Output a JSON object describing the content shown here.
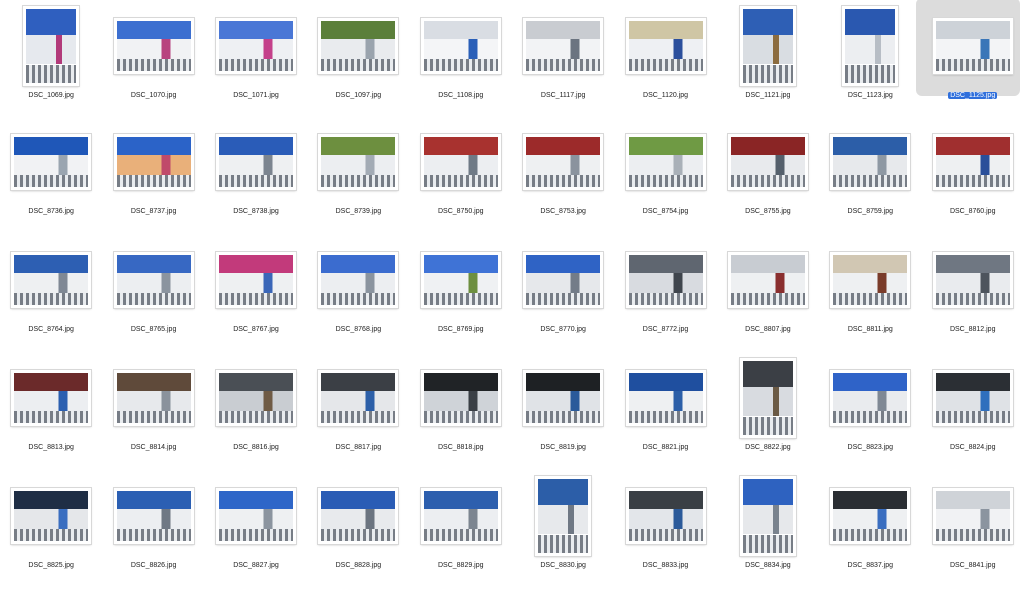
{
  "colors": {
    "selection": "#2f6fdc",
    "selectionBg": "#dcdcdc"
  },
  "files": [
    {
      "name": "DSC_1069.jpg",
      "orient": "portrait",
      "colors": [
        "#2f5fbf",
        "#e6e9ee",
        "#b23a7a"
      ]
    },
    {
      "name": "DSC_1070.jpg",
      "orient": "landscape",
      "colors": [
        "#3c6fd0",
        "#f1f2f4",
        "#b8447f"
      ]
    },
    {
      "name": "DSC_1071.jpg",
      "orient": "landscape",
      "colors": [
        "#4a77d6",
        "#eef0f3",
        "#c4408a"
      ]
    },
    {
      "name": "DSC_1097.jpg",
      "orient": "landscape",
      "colors": [
        "#5b7f3a",
        "#e9ebee",
        "#9aa3ad"
      ]
    },
    {
      "name": "DSC_1108.jpg",
      "orient": "landscape",
      "colors": [
        "#d9dde3",
        "#f4f5f7",
        "#2a5fb8"
      ]
    },
    {
      "name": "DSC_1117.jpg",
      "orient": "landscape",
      "colors": [
        "#c9ccd1",
        "#f2f3f5",
        "#6b7480"
      ]
    },
    {
      "name": "DSC_1120.jpg",
      "orient": "landscape",
      "colors": [
        "#cfc6a5",
        "#eef0f3",
        "#2b4f9c"
      ]
    },
    {
      "name": "DSC_1121.jpg",
      "orient": "portrait",
      "colors": [
        "#2e5fb5",
        "#d9dde2",
        "#8c6c3f"
      ]
    },
    {
      "name": "DSC_1123.jpg",
      "orient": "portrait",
      "colors": [
        "#2a58b0",
        "#eceef1",
        "#b7bdc5"
      ]
    },
    {
      "name": "DSC_1125.jpg",
      "orient": "landscape",
      "colors": [
        "#cdd2d8",
        "#f3f4f6",
        "#3a76b8"
      ],
      "selected": true
    },
    {
      "name": "DSC_8736.jpg",
      "orient": "landscape",
      "colors": [
        "#1f57b8",
        "#f1f2f4",
        "#9aa5b0"
      ]
    },
    {
      "name": "DSC_8737.jpg",
      "orient": "landscape",
      "colors": [
        "#2b63c8",
        "#e9b07a",
        "#c04a6a"
      ]
    },
    {
      "name": "DSC_8738.jpg",
      "orient": "landscape",
      "colors": [
        "#2a5cb8",
        "#eef0f2",
        "#7c8590"
      ]
    },
    {
      "name": "DSC_8739.jpg",
      "orient": "landscape",
      "colors": [
        "#6d8f3f",
        "#eceef1",
        "#a3abb5"
      ]
    },
    {
      "name": "DSC_8750.jpg",
      "orient": "landscape",
      "colors": [
        "#a8322f",
        "#eceef1",
        "#6f7a86"
      ]
    },
    {
      "name": "DSC_8753.jpg",
      "orient": "landscape",
      "colors": [
        "#9c2a2a",
        "#eef0f2",
        "#8a939e"
      ]
    },
    {
      "name": "DSC_8754.jpg",
      "orient": "landscape",
      "colors": [
        "#6f9a44",
        "#eceef1",
        "#a9b0b8"
      ]
    },
    {
      "name": "DSC_8755.jpg",
      "orient": "landscape",
      "colors": [
        "#8a2525",
        "#e8eaed",
        "#55606c"
      ]
    },
    {
      "name": "DSC_8759.jpg",
      "orient": "landscape",
      "colors": [
        "#2c5ea8",
        "#e7e9ec",
        "#8e98a3"
      ]
    },
    {
      "name": "DSC_8760.jpg",
      "orient": "landscape",
      "colors": [
        "#a02f2f",
        "#eef0f2",
        "#2a4f9a"
      ]
    },
    {
      "name": "DSC_8764.jpg",
      "orient": "landscape",
      "colors": [
        "#2d5fb3",
        "#eef0f2",
        "#7f8894"
      ]
    },
    {
      "name": "DSC_8765.jpg",
      "orient": "landscape",
      "colors": [
        "#3768c3",
        "#eceef1",
        "#8b949f"
      ]
    },
    {
      "name": "DSC_8767.jpg",
      "orient": "landscape",
      "colors": [
        "#c23a7b",
        "#eef0f2",
        "#3a66b8"
      ]
    },
    {
      "name": "DSC_8768.jpg",
      "orient": "landscape",
      "colors": [
        "#3b6ccf",
        "#eceef1",
        "#8b949f"
      ]
    },
    {
      "name": "DSC_8769.jpg",
      "orient": "landscape",
      "colors": [
        "#3f73d6",
        "#eff1f3",
        "#6d8f3f"
      ]
    },
    {
      "name": "DSC_8770.jpg",
      "orient": "landscape",
      "colors": [
        "#2f63c5",
        "#e6e8eb",
        "#737c88"
      ]
    },
    {
      "name": "DSC_8772.jpg",
      "orient": "landscape",
      "colors": [
        "#5f6670",
        "#d8dbe0",
        "#3f454d"
      ]
    },
    {
      "name": "DSC_8807.jpg",
      "orient": "landscape",
      "colors": [
        "#c8ccd2",
        "#eef0f2",
        "#8a2f2f"
      ]
    },
    {
      "name": "DSC_8811.jpg",
      "orient": "landscape",
      "colors": [
        "#d1c7b3",
        "#eef0f2",
        "#7a3c2a"
      ]
    },
    {
      "name": "DSC_8812.jpg",
      "orient": "landscape",
      "colors": [
        "#6f7782",
        "#e9ebee",
        "#4d545d"
      ]
    },
    {
      "name": "DSC_8813.jpg",
      "orient": "landscape",
      "colors": [
        "#6b2a2a",
        "#eceef1",
        "#2b5fb0"
      ]
    },
    {
      "name": "DSC_8814.jpg",
      "orient": "landscape",
      "colors": [
        "#5f4a3a",
        "#e7e9ec",
        "#8a929c"
      ]
    },
    {
      "name": "DSC_8816.jpg",
      "orient": "landscape",
      "colors": [
        "#4a4f55",
        "#c9cdd2",
        "#6f5b45"
      ]
    },
    {
      "name": "DSC_8817.jpg",
      "orient": "landscape",
      "colors": [
        "#3b3f45",
        "#e5e7ea",
        "#2c5fa8"
      ]
    },
    {
      "name": "DSC_8818.jpg",
      "orient": "landscape",
      "colors": [
        "#202326",
        "#cfd3d8",
        "#3a3f45"
      ]
    },
    {
      "name": "DSC_8819.jpg",
      "orient": "landscape",
      "colors": [
        "#1e2124",
        "#e0e3e7",
        "#2a5a9a"
      ]
    },
    {
      "name": "DSC_8821.jpg",
      "orient": "landscape",
      "colors": [
        "#1f4f9f",
        "#eef0f2",
        "#2c5fa8"
      ]
    },
    {
      "name": "DSC_8822.jpg",
      "orient": "portrait",
      "colors": [
        "#3b3f45",
        "#d8dbe0",
        "#6b5a45"
      ]
    },
    {
      "name": "DSC_8823.jpg",
      "orient": "landscape",
      "colors": [
        "#2f63c8",
        "#e9ebee",
        "#7f8894"
      ]
    },
    {
      "name": "DSC_8824.jpg",
      "orient": "landscape",
      "colors": [
        "#2b2f34",
        "#dfe2e6",
        "#2f6fbd"
      ]
    },
    {
      "name": "DSC_8825.jpg",
      "orient": "landscape",
      "colors": [
        "#1f2e45",
        "#e5e7ea",
        "#3a6ec0"
      ]
    },
    {
      "name": "DSC_8826.jpg",
      "orient": "landscape",
      "colors": [
        "#2b5fb3",
        "#eceef1",
        "#6f7884"
      ]
    },
    {
      "name": "DSC_8827.jpg",
      "orient": "landscape",
      "colors": [
        "#2e66c8",
        "#eef0f2",
        "#8b949f"
      ]
    },
    {
      "name": "DSC_8828.jpg",
      "orient": "landscape",
      "colors": [
        "#2a5cb5",
        "#e8eaed",
        "#6b7480"
      ]
    },
    {
      "name": "DSC_8829.jpg",
      "orient": "landscape",
      "colors": [
        "#2d5fae",
        "#eceef1",
        "#7c8590"
      ]
    },
    {
      "name": "DSC_8830.jpg",
      "orient": "portrait",
      "colors": [
        "#2c5ea8",
        "#e7e9ec",
        "#6f7884"
      ]
    },
    {
      "name": "DSC_8833.jpg",
      "orient": "landscape",
      "colors": [
        "#3a3f45",
        "#e3e6ea",
        "#2b5a9a"
      ]
    },
    {
      "name": "DSC_8834.jpg",
      "orient": "portrait",
      "colors": [
        "#2e62c0",
        "#e6e8eb",
        "#7a838e"
      ]
    },
    {
      "name": "DSC_8837.jpg",
      "orient": "landscape",
      "colors": [
        "#2a2e33",
        "#eef0f2",
        "#3a6ec0"
      ]
    },
    {
      "name": "DSC_8841.jpg",
      "orient": "landscape",
      "colors": [
        "#cfd3d8",
        "#f1f2f4",
        "#8b949f"
      ]
    }
  ]
}
